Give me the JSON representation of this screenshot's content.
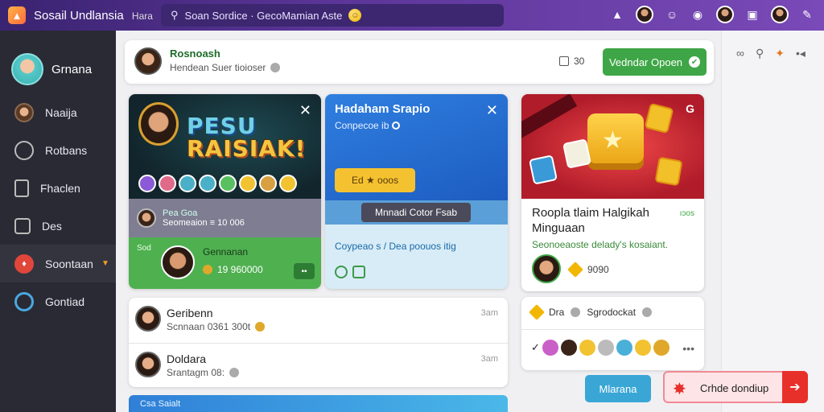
{
  "topbar": {
    "app_title": "Sosail Undlansia",
    "app_subtitle": "Hara",
    "search_text": "Soan Sordice · GecoMamian Aste",
    "icons": [
      "search-icon",
      "bell-icon",
      "avatar",
      "smile-icon",
      "location-icon",
      "avatar",
      "image-icon",
      "avatar",
      "edit-icon"
    ]
  },
  "sidebar": {
    "user_name": "Grnana",
    "items": [
      {
        "label": "Naaija",
        "icon": "profile-face-icon"
      },
      {
        "label": "Rotbans",
        "icon": "chat-icon"
      },
      {
        "label": "Fhaclen",
        "icon": "document-icon"
      },
      {
        "label": "Des",
        "icon": "chart-icon"
      },
      {
        "label": "Soontaan",
        "icon": "fire-icon"
      },
      {
        "label": "Gontiad",
        "icon": "ring-icon"
      }
    ]
  },
  "header": {
    "title": "Rosnoash",
    "subtitle": "Hendean Suer tioioser",
    "count": "30",
    "button_label": "Vedndar Opoen"
  },
  "card1": {
    "big_text_line1": "PESU",
    "big_text_line2": "RAISIAK!",
    "mid_line1": "Pea Goa",
    "mid_line2": "Seomeaion ≡ 10 006",
    "bot_small": "Sod",
    "bot_name": "Gennanan",
    "bot_nums": "19 960000"
  },
  "card2": {
    "title": "Hadaham Srapio",
    "subtitle": "Conpecoe ib",
    "button_label": "Ed ★ ooos",
    "tooltip": "Mnnadi Cotor Fsab",
    "text": "Coypeao s / Dea poouos itig"
  },
  "card3": {
    "title": "Roopla tlaim Halgikah Minguaan",
    "tag": "ıɔos",
    "subtitle": "Seonoeaoste delady's kosaiant.",
    "meta": "9090"
  },
  "feed": [
    {
      "name": "Geribenn",
      "sub": "Scnnaan 0361 300t",
      "time": "3am"
    },
    {
      "name": "Doldara",
      "sub": "Srantagm 08:",
      "time": "3am"
    }
  ],
  "reactions_card": {
    "label1": "Dra",
    "label2": "Sgrodockat"
  },
  "buttons": {
    "blue": "Mlarana",
    "pink": "Crhde dondiup"
  },
  "bottom_bar": "Csa Saialt"
}
